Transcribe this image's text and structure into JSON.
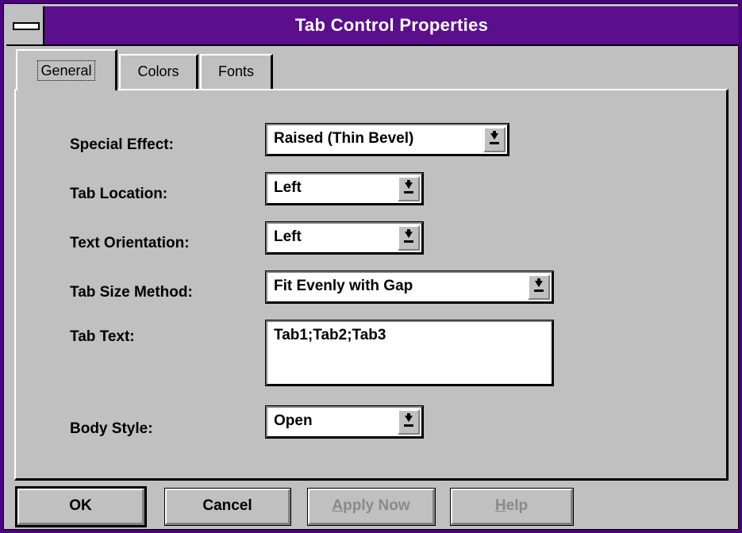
{
  "window": {
    "title": "Tab Control Properties"
  },
  "tabs": [
    {
      "label": "General",
      "active": true
    },
    {
      "label": "Colors",
      "active": false
    },
    {
      "label": "Fonts",
      "active": false
    }
  ],
  "fields": {
    "special_effect": {
      "label": "Special Effect:",
      "value": "Raised (Thin Bevel)"
    },
    "tab_location": {
      "label": "Tab Location:",
      "value": "Left"
    },
    "text_orientation": {
      "label": "Text Orientation:",
      "value": "Left"
    },
    "tab_size_method": {
      "label": "Tab Size Method:",
      "value": "Fit Evenly with Gap"
    },
    "tab_text": {
      "label": "Tab Text:",
      "value": "Tab1;Tab2;Tab3"
    },
    "body_style": {
      "label": "Body Style:",
      "value": "Open"
    }
  },
  "buttons": {
    "ok": "OK",
    "cancel": "Cancel",
    "apply_now_accel": "A",
    "apply_now_rest": "pply Now",
    "help_accel": "H",
    "help_rest": "elp"
  },
  "colors": {
    "titlebar": "#5b0f8c",
    "face": "#c0c0c0",
    "disabled_text": "#8a8a8a"
  },
  "icons": {
    "system_menu": "system-menu-icon",
    "dropdown": "dropdown-arrow-icon"
  }
}
